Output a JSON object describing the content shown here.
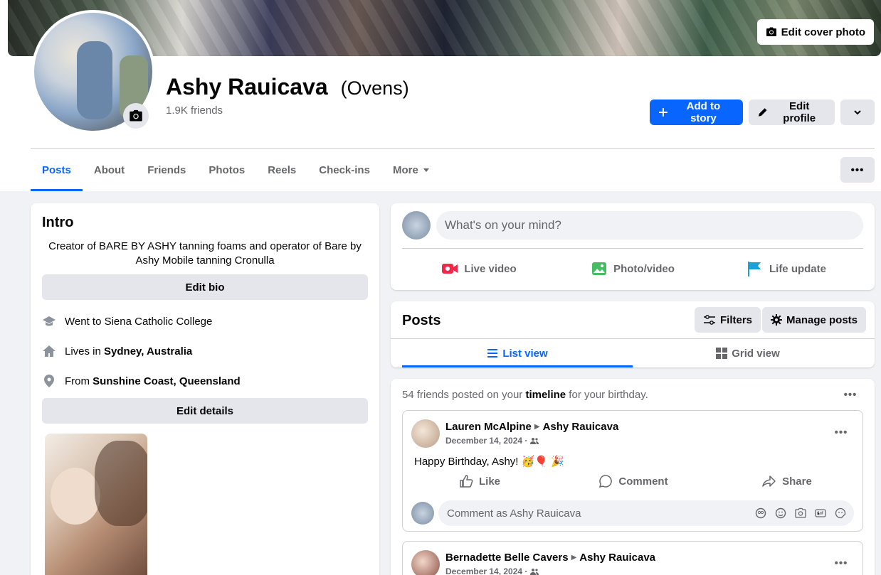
{
  "cover": {
    "edit_label": "Edit cover photo"
  },
  "profile": {
    "name": "Ashy Rauicava",
    "alt_name": "(Ovens)",
    "friends": "1.9K friends",
    "add_story": "Add to story",
    "edit_profile": "Edit profile"
  },
  "tabs": [
    "Posts",
    "About",
    "Friends",
    "Photos",
    "Reels",
    "Check-ins",
    "More"
  ],
  "intro": {
    "title": "Intro",
    "bio": "Creator of BARE BY ASHY tanning foams and operator of Bare by Ashy Mobile tanning Cronulla",
    "edit_bio": "Edit bio",
    "school_text": "Went to Siena Catholic College",
    "lives_prefix": "Lives in ",
    "lives_place": "Sydney, Australia",
    "from_prefix": "From ",
    "from_place": "Sunshine Coast, Queensland",
    "edit_details": "Edit details"
  },
  "composer": {
    "placeholder": "What's on your mind?",
    "live": "Live video",
    "photo": "Photo/video",
    "life": "Life update"
  },
  "posts_header": {
    "title": "Posts",
    "filters": "Filters",
    "manage": "Manage posts",
    "list_view": "List view",
    "grid_view": "Grid view"
  },
  "birthday": {
    "prefix": "54 friends posted on your ",
    "timeline": "timeline",
    "suffix": " for your birthday."
  },
  "posts": [
    {
      "author": "Lauren McAlpine",
      "target": "Ashy Rauicava",
      "date": "December 14, 2024 ·",
      "text": "Happy Birthday, Ashy! 🥳🎈 🎉"
    },
    {
      "author": "Bernadette Belle Cavers",
      "target": "Ashy Rauicava",
      "date": "December 14, 2024 ·"
    }
  ],
  "actions": {
    "like": "Like",
    "comment": "Comment",
    "share": "Share"
  },
  "comment_placeholder": "Comment as Ashy Rauicava",
  "colors": {
    "accent": "#0866ff",
    "secondary_button": "#e4e6eb",
    "background": "#f0f2f5",
    "muted_text": "#65676b"
  }
}
